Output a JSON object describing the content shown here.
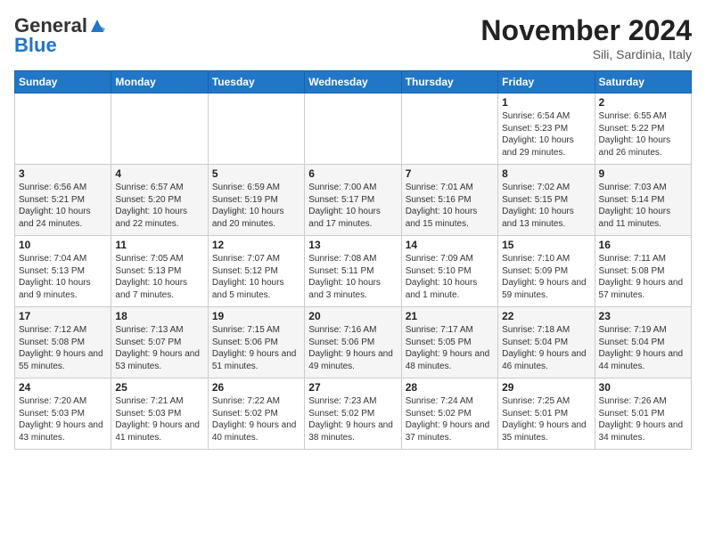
{
  "header": {
    "logo_general": "General",
    "logo_blue": "Blue",
    "month_title": "November 2024",
    "location": "Sili, Sardinia, Italy"
  },
  "weekdays": [
    "Sunday",
    "Monday",
    "Tuesday",
    "Wednesday",
    "Thursday",
    "Friday",
    "Saturday"
  ],
  "weeks": [
    [
      {
        "day": "",
        "info": ""
      },
      {
        "day": "",
        "info": ""
      },
      {
        "day": "",
        "info": ""
      },
      {
        "day": "",
        "info": ""
      },
      {
        "day": "",
        "info": ""
      },
      {
        "day": "1",
        "info": "Sunrise: 6:54 AM\nSunset: 5:23 PM\nDaylight: 10 hours and 29 minutes."
      },
      {
        "day": "2",
        "info": "Sunrise: 6:55 AM\nSunset: 5:22 PM\nDaylight: 10 hours and 26 minutes."
      }
    ],
    [
      {
        "day": "3",
        "info": "Sunrise: 6:56 AM\nSunset: 5:21 PM\nDaylight: 10 hours and 24 minutes."
      },
      {
        "day": "4",
        "info": "Sunrise: 6:57 AM\nSunset: 5:20 PM\nDaylight: 10 hours and 22 minutes."
      },
      {
        "day": "5",
        "info": "Sunrise: 6:59 AM\nSunset: 5:19 PM\nDaylight: 10 hours and 20 minutes."
      },
      {
        "day": "6",
        "info": "Sunrise: 7:00 AM\nSunset: 5:17 PM\nDaylight: 10 hours and 17 minutes."
      },
      {
        "day": "7",
        "info": "Sunrise: 7:01 AM\nSunset: 5:16 PM\nDaylight: 10 hours and 15 minutes."
      },
      {
        "day": "8",
        "info": "Sunrise: 7:02 AM\nSunset: 5:15 PM\nDaylight: 10 hours and 13 minutes."
      },
      {
        "day": "9",
        "info": "Sunrise: 7:03 AM\nSunset: 5:14 PM\nDaylight: 10 hours and 11 minutes."
      }
    ],
    [
      {
        "day": "10",
        "info": "Sunrise: 7:04 AM\nSunset: 5:13 PM\nDaylight: 10 hours and 9 minutes."
      },
      {
        "day": "11",
        "info": "Sunrise: 7:05 AM\nSunset: 5:13 PM\nDaylight: 10 hours and 7 minutes."
      },
      {
        "day": "12",
        "info": "Sunrise: 7:07 AM\nSunset: 5:12 PM\nDaylight: 10 hours and 5 minutes."
      },
      {
        "day": "13",
        "info": "Sunrise: 7:08 AM\nSunset: 5:11 PM\nDaylight: 10 hours and 3 minutes."
      },
      {
        "day": "14",
        "info": "Sunrise: 7:09 AM\nSunset: 5:10 PM\nDaylight: 10 hours and 1 minute."
      },
      {
        "day": "15",
        "info": "Sunrise: 7:10 AM\nSunset: 5:09 PM\nDaylight: 9 hours and 59 minutes."
      },
      {
        "day": "16",
        "info": "Sunrise: 7:11 AM\nSunset: 5:08 PM\nDaylight: 9 hours and 57 minutes."
      }
    ],
    [
      {
        "day": "17",
        "info": "Sunrise: 7:12 AM\nSunset: 5:08 PM\nDaylight: 9 hours and 55 minutes."
      },
      {
        "day": "18",
        "info": "Sunrise: 7:13 AM\nSunset: 5:07 PM\nDaylight: 9 hours and 53 minutes."
      },
      {
        "day": "19",
        "info": "Sunrise: 7:15 AM\nSunset: 5:06 PM\nDaylight: 9 hours and 51 minutes."
      },
      {
        "day": "20",
        "info": "Sunrise: 7:16 AM\nSunset: 5:06 PM\nDaylight: 9 hours and 49 minutes."
      },
      {
        "day": "21",
        "info": "Sunrise: 7:17 AM\nSunset: 5:05 PM\nDaylight: 9 hours and 48 minutes."
      },
      {
        "day": "22",
        "info": "Sunrise: 7:18 AM\nSunset: 5:04 PM\nDaylight: 9 hours and 46 minutes."
      },
      {
        "day": "23",
        "info": "Sunrise: 7:19 AM\nSunset: 5:04 PM\nDaylight: 9 hours and 44 minutes."
      }
    ],
    [
      {
        "day": "24",
        "info": "Sunrise: 7:20 AM\nSunset: 5:03 PM\nDaylight: 9 hours and 43 minutes."
      },
      {
        "day": "25",
        "info": "Sunrise: 7:21 AM\nSunset: 5:03 PM\nDaylight: 9 hours and 41 minutes."
      },
      {
        "day": "26",
        "info": "Sunrise: 7:22 AM\nSunset: 5:02 PM\nDaylight: 9 hours and 40 minutes."
      },
      {
        "day": "27",
        "info": "Sunrise: 7:23 AM\nSunset: 5:02 PM\nDaylight: 9 hours and 38 minutes."
      },
      {
        "day": "28",
        "info": "Sunrise: 7:24 AM\nSunset: 5:02 PM\nDaylight: 9 hours and 37 minutes."
      },
      {
        "day": "29",
        "info": "Sunrise: 7:25 AM\nSunset: 5:01 PM\nDaylight: 9 hours and 35 minutes."
      },
      {
        "day": "30",
        "info": "Sunrise: 7:26 AM\nSunset: 5:01 PM\nDaylight: 9 hours and 34 minutes."
      }
    ]
  ]
}
